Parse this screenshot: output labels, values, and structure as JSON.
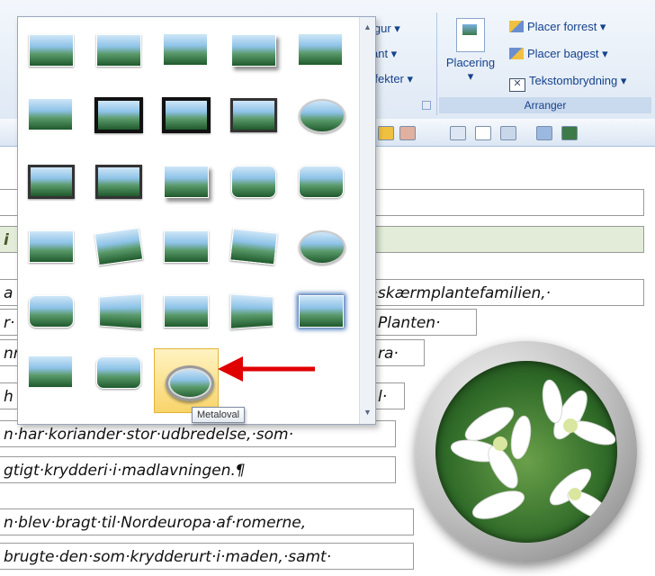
{
  "ribbon": {
    "partial_group": {
      "items": [
        "igur ▾",
        "ant ▾",
        "ffekter ▾"
      ]
    },
    "arrange": {
      "placering_label": "Placering",
      "placering_caret": "▾",
      "items": [
        {
          "label": "Placer forrest ▾",
          "icon": "bring-forward-icon"
        },
        {
          "label": "Placer bagest ▾",
          "icon": "send-backward-icon"
        },
        {
          "label": "Tekstombrydning ▾",
          "icon": "text-wrap-icon"
        }
      ],
      "group_label": "Arranger"
    }
  },
  "document": {
    "lines": [
      "",
      "i",
      "a",
      "r·",
      "nr",
      "h",
      "n·har·koriander·stor·udbredelse,·som·",
      "gtigt·krydderi·i·madlavningen.¶",
      "n·blev·bragt·til·Nordeuropa·af·romerne,",
      "brugte·den·som·krydderurt·i·maden,·samt·"
    ],
    "right_fragments": [
      "r·til·skærmplantefamilien,·",
      "Planten·",
      "ra·",
      "l·"
    ]
  },
  "gallery": {
    "scroll_up": "▲",
    "scroll_down": "▼",
    "selected_style": "Metaloval",
    "tooltip": "Metaloval"
  }
}
